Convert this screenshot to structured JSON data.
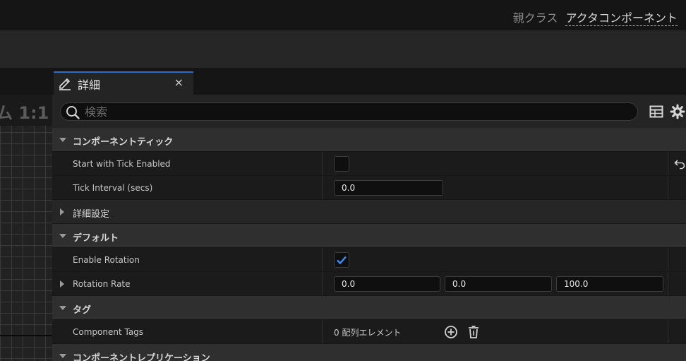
{
  "header": {
    "parent_class_label": "親クラス",
    "parent_class_value": "アクタコンポーネント"
  },
  "tab": {
    "title": "詳細",
    "close": "×",
    "accent": "#2a6fc9"
  },
  "viewport": {
    "label": "ム 1:1"
  },
  "search": {
    "placeholder": "検索",
    "value": ""
  },
  "icons": {
    "search": "search-icon",
    "table_view": "table-view-icon",
    "settings": "gear-icon",
    "reset": "reset-to-default-icon",
    "add": "add-element-icon",
    "delete": "trash-icon"
  },
  "details": {
    "component_tick": {
      "label": "コンポーネントティック",
      "start_with_tick_enabled": {
        "label": "Start with Tick Enabled",
        "checked": false
      },
      "tick_interval": {
        "label": "Tick Interval (secs)",
        "value": "0.0"
      }
    },
    "advanced": {
      "label": "詳細設定"
    },
    "default": {
      "label": "デフォルト",
      "enable_rotation": {
        "label": "Enable Rotation",
        "checked": true
      },
      "rotation_rate": {
        "label": "Rotation Rate",
        "x": "0.0",
        "y": "0.0",
        "z": "100.0"
      }
    },
    "tags": {
      "label": "タグ",
      "component_tags": {
        "label": "Component Tags",
        "value": "0 配列エレメント"
      }
    },
    "component_replication": {
      "label": "コンポーネントレプリケーション"
    }
  },
  "colors": {
    "checkbox_accent": "#3d8fff"
  }
}
